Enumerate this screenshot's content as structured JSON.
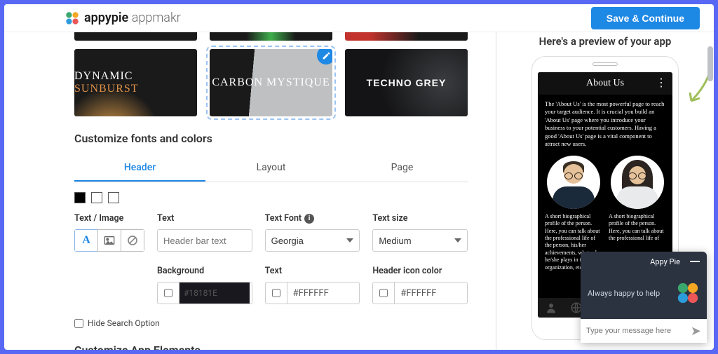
{
  "brand": {
    "bold": "appypie",
    "light": "appmakr"
  },
  "header": {
    "save_btn": "Save & Continue"
  },
  "themes": {
    "sunburst": {
      "part1": "DYNAMIC ",
      "part2": "SUNBURST"
    },
    "mystique": "CARBON MYSTIQUE",
    "techno": "TECHNO GREY"
  },
  "sections": {
    "customize_fonts": "Customize fonts and colors",
    "customize_elements": "Customize App Elements"
  },
  "tabs": {
    "header": "Header",
    "layout": "Layout",
    "page": "Page"
  },
  "form": {
    "text_image": "Text / Image",
    "text": "Text",
    "text_placeholder": "Header bar text",
    "font": "Text Font",
    "font_value": "Georgia",
    "size": "Text size",
    "size_value": "Medium",
    "background": "Background",
    "background_value": "#18181E",
    "text_color": "Text",
    "text_color_value": "#FFFFFF",
    "icon_color": "Header icon color",
    "icon_color_value": "#FFFFFF",
    "hide_search": "Hide Search Option"
  },
  "preview": {
    "title": "Here's a preview of your app",
    "screen_title": "About Us",
    "intro": "The 'About Us' is the most powerful page to reach your target audience. It is crucial you build an 'About Us' page where you introduce your business to your potential customers. Having a good 'About Us' page is a vital component to attract new users.",
    "bio1": "A short biographical profile of the person. Here, you can talk about the professional life of the person, his/her achievements, what role he/she plays in the organization, etc.",
    "bio2": "A short biographical profile of the person. Here, you can talk about the professional life of"
  },
  "chat": {
    "name": "Appy Pie",
    "body": "Always happy to help",
    "placeholder": "Type your message here"
  }
}
